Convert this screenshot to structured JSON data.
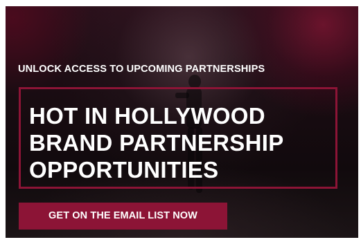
{
  "banner": {
    "eyebrow": "UNLOCK ACCESS TO UPCOMING PARTNERSHIPS",
    "headline_lines": [
      "HOT IN HOLLYWOOD",
      "BRAND PARTNERSHIP",
      "OPPORTUNITIES"
    ],
    "cta_label": "GET ON THE EMAIL LIST NOW"
  },
  "colors": {
    "accent": "#8c1436",
    "text": "#ffffff",
    "background": "#1a0c12"
  }
}
